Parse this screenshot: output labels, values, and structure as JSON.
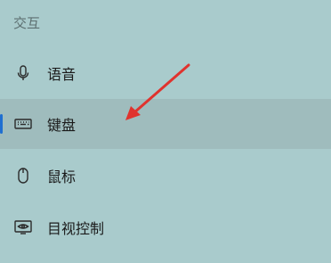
{
  "section": {
    "title": "交互"
  },
  "nav": {
    "items": [
      {
        "label": "语音",
        "icon": "microphone-icon"
      },
      {
        "label": "键盘",
        "icon": "keyboard-icon",
        "selected": true
      },
      {
        "label": "鼠标",
        "icon": "mouse-icon"
      },
      {
        "label": "目视控制",
        "icon": "eye-monitor-icon"
      }
    ]
  },
  "colors": {
    "background": "#a9cbcc",
    "selected_background": "#9fbcbd",
    "selection_indicator": "#1f6fd1",
    "annotation_arrow": "#e0332e"
  }
}
